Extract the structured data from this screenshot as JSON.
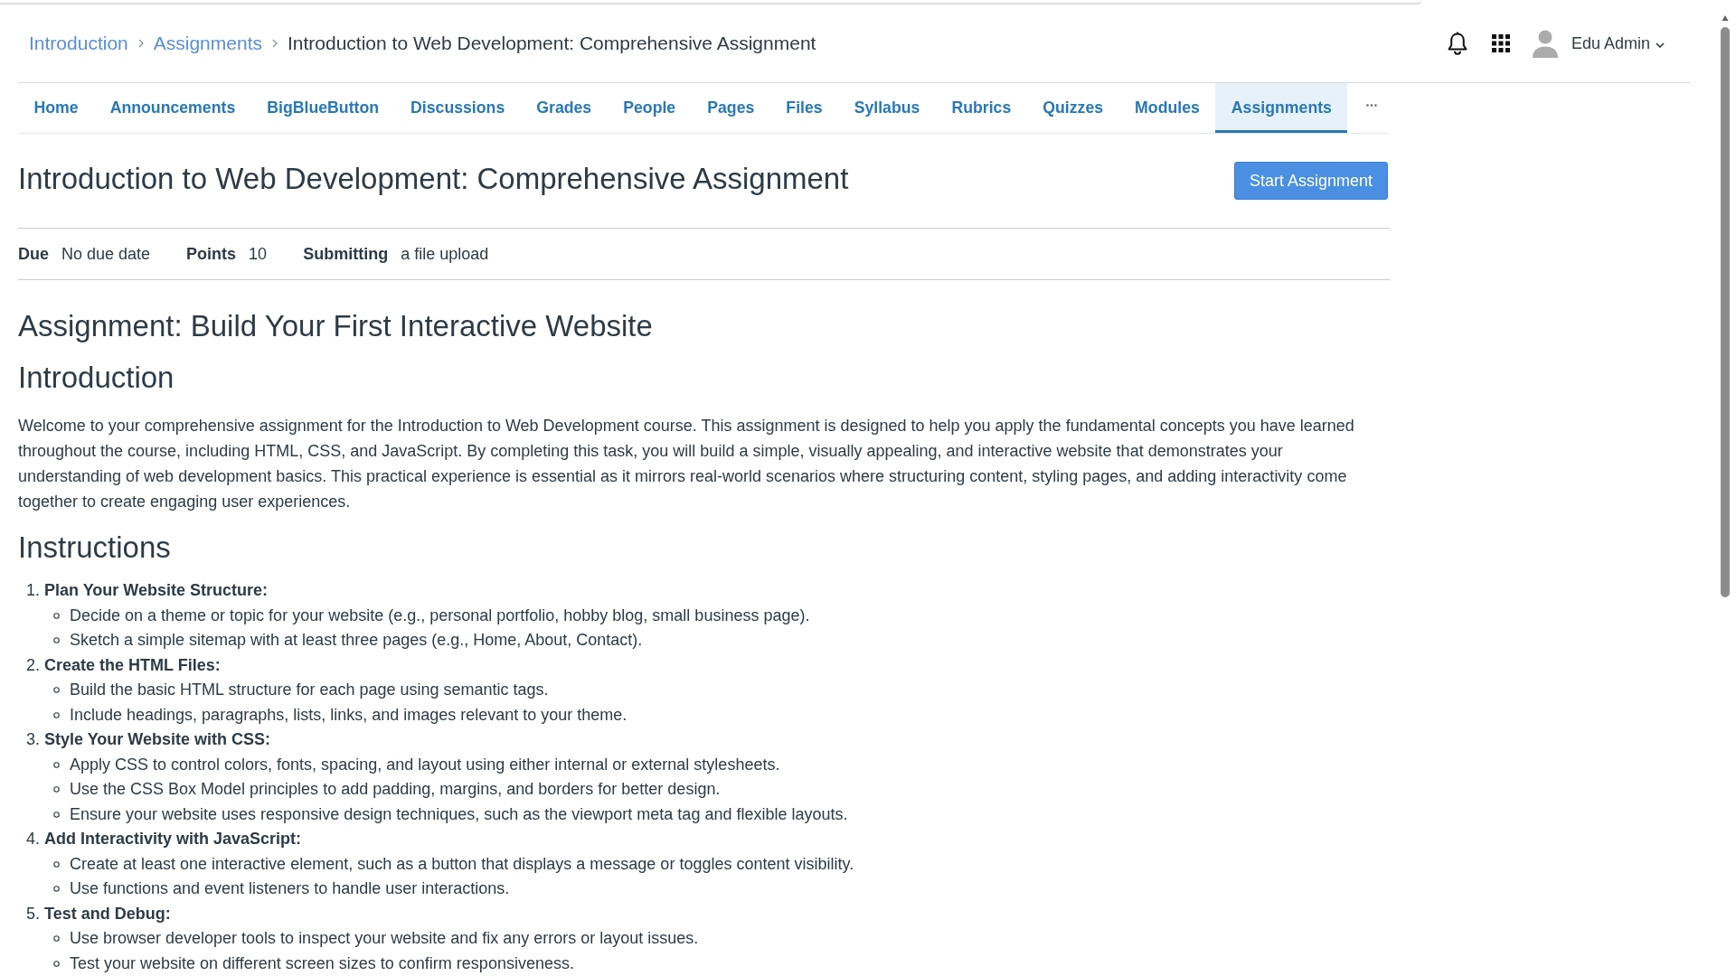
{
  "breadcrumb": [
    {
      "label": "Introduction",
      "kind": "link"
    },
    {
      "label": "Assignments",
      "kind": "link"
    },
    {
      "label": "Introduction to Web Development: Comprehensive Assignment",
      "kind": "current"
    }
  ],
  "user_menu": {
    "name": "Edu Admin"
  },
  "course_nav": [
    {
      "label": "Home",
      "selected": false
    },
    {
      "label": "Announcements",
      "selected": false
    },
    {
      "label": "BigBlueButton",
      "selected": false
    },
    {
      "label": "Discussions",
      "selected": false
    },
    {
      "label": "Grades",
      "selected": false
    },
    {
      "label": "People",
      "selected": false
    },
    {
      "label": "Pages",
      "selected": false
    },
    {
      "label": "Files",
      "selected": false
    },
    {
      "label": "Syllabus",
      "selected": false
    },
    {
      "label": "Rubrics",
      "selected": false
    },
    {
      "label": "Quizzes",
      "selected": false
    },
    {
      "label": "Modules",
      "selected": false
    },
    {
      "label": "Assignments",
      "selected": true
    }
  ],
  "assignment": {
    "title": "Introduction to Web Development: Comprehensive Assignment",
    "start_button": "Start Assignment",
    "details": [
      {
        "label": "Due",
        "value": "No due date"
      },
      {
        "label": "Points",
        "value": "10"
      },
      {
        "label": "Submitting",
        "value": "a file upload"
      }
    ],
    "body": [
      {
        "kind": "heading",
        "text": "Assignment: Build Your First Interactive Website"
      },
      {
        "kind": "heading",
        "text": "Introduction"
      },
      {
        "kind": "paragraph",
        "text": "Welcome to your comprehensive assignment for the Introduction to Web Development course. This assignment is designed to help you apply the fundamental concepts you have learned throughout the course, including HTML, CSS, and JavaScript. By completing this task, you will build a simple, visually appealing, and interactive website that demonstrates your understanding of web development basics. This practical experience is essential as it mirrors real-world scenarios where structuring content, styling pages, and adding interactivity come together to create engaging user experiences."
      },
      {
        "kind": "heading",
        "text": "Instructions"
      },
      {
        "kind": "steps",
        "items": [
          {
            "number": "1.",
            "title": "Plan Your Website Structure:",
            "points": [
              "Decide on a theme or topic for your website (e.g., personal portfolio, hobby blog, small business page).",
              "Sketch a simple sitemap with at least three pages (e.g., Home, About, Contact)."
            ]
          },
          {
            "number": "2.",
            "title": "Create the HTML Files:",
            "points": [
              "Build the basic HTML structure for each page using semantic tags.",
              "Include headings, paragraphs, lists, links, and images relevant to your theme."
            ]
          },
          {
            "number": "3.",
            "title": "Style Your Website with CSS:",
            "points": [
              "Apply CSS to control colors, fonts, spacing, and layout using either internal or external stylesheets.",
              "Use the CSS Box Model principles to add padding, margins, and borders for better design.",
              "Ensure your website uses responsive design techniques, such as the viewport meta tag and flexible layouts."
            ]
          },
          {
            "number": "4.",
            "title": "Add Interactivity with JavaScript:",
            "points": [
              "Create at least one interactive element, such as a button that displays a message or toggles content visibility.",
              "Use functions and event listeners to handle user interactions."
            ]
          },
          {
            "number": "5.",
            "title": "Test and Debug:",
            "points": [
              "Use browser developer tools to inspect your website and fix any errors or layout issues.",
              "Test your website on different screen sizes to confirm responsiveness."
            ]
          }
        ]
      }
    ]
  }
}
